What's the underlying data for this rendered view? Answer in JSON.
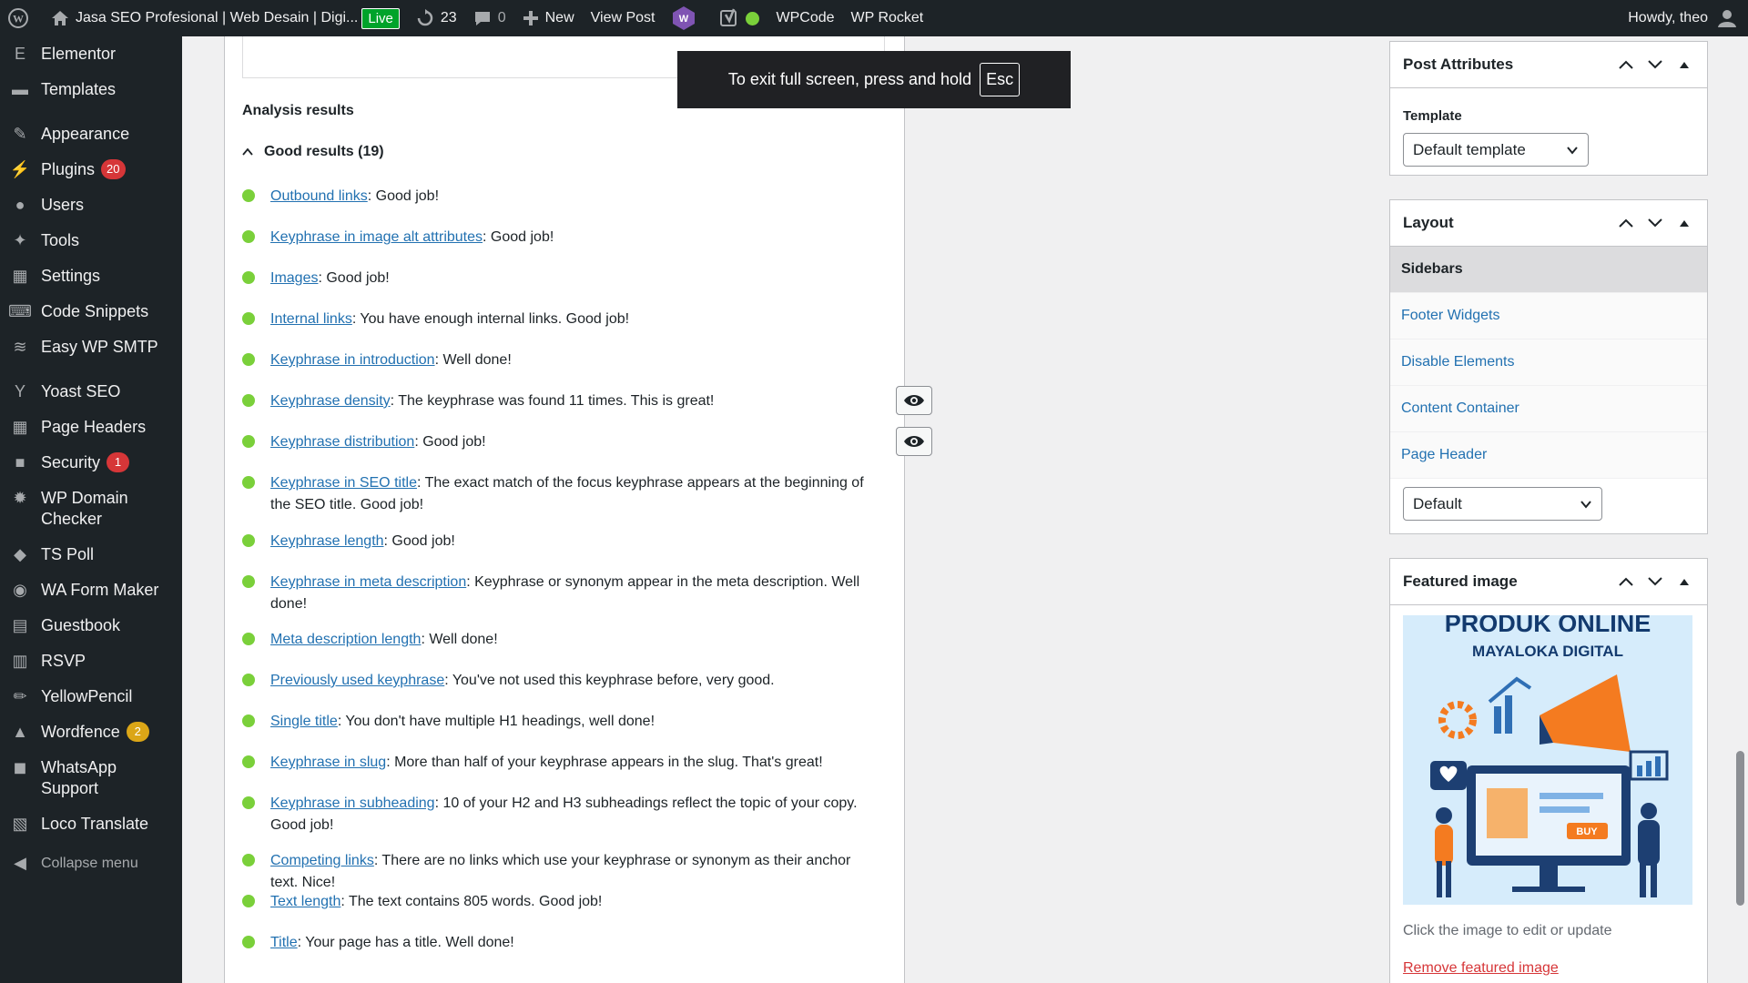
{
  "adminbar": {
    "site_title": "Jasa SEO Profesional | Web Desain | Digi...",
    "live_label": "Live",
    "updates_count": "23",
    "comments_count": "0",
    "new_label": "New",
    "view_post_label": "View Post",
    "wpcode_label": "WPCode",
    "wprocket_label": "WP Rocket",
    "howdy_label": "Howdy, theo"
  },
  "menu": {
    "items": [
      {
        "label": "Elementor",
        "icon": "elementor-icon"
      },
      {
        "label": "Templates",
        "icon": "folder-icon"
      },
      {
        "label": "Appearance",
        "icon": "brush-icon"
      },
      {
        "label": "Plugins",
        "icon": "plugin-icon",
        "count": "20"
      },
      {
        "label": "Users",
        "icon": "user-icon"
      },
      {
        "label": "Tools",
        "icon": "wrench-icon"
      },
      {
        "label": "Settings",
        "icon": "settings-icon"
      },
      {
        "label": "Code Snippets",
        "icon": "code-icon"
      },
      {
        "label": "Easy WP SMTP",
        "icon": "mail-icon"
      },
      {
        "label": "Yoast SEO",
        "icon": "yoast-icon"
      },
      {
        "label": "Page Headers",
        "icon": "grid-icon"
      },
      {
        "label": "Security",
        "icon": "lock-icon",
        "count": "1"
      },
      {
        "label": "WP Domain Checker",
        "icon": "gear-icon"
      },
      {
        "label": "TS Poll",
        "icon": "poll-icon"
      },
      {
        "label": "WA Form Maker",
        "icon": "whatsapp-icon"
      },
      {
        "label": "Guestbook",
        "icon": "comment-icon"
      },
      {
        "label": "RSVP",
        "icon": "calendar-icon"
      },
      {
        "label": "YellowPencil",
        "icon": "pencil-icon"
      },
      {
        "label": "Wordfence",
        "icon": "wordfence-icon",
        "count": "2"
      },
      {
        "label": "WhatsApp Support",
        "icon": "chat-icon"
      },
      {
        "label": "Loco Translate",
        "icon": "translate-icon"
      }
    ],
    "collapse_label": "Collapse menu"
  },
  "analysis": {
    "heading": "Analysis results",
    "good_label": "Good results (19)",
    "results": [
      {
        "link": "Outbound links",
        "text": ": Good job!"
      },
      {
        "link": "Keyphrase in image alt attributes",
        "text": ": Good job!"
      },
      {
        "link": "Images",
        "text": ": Good job!"
      },
      {
        "link": "Internal links",
        "text": ": You have enough internal links. Good job!"
      },
      {
        "link": "Keyphrase in introduction",
        "text": ": Well done!"
      },
      {
        "link": "Keyphrase density",
        "text": ": The keyphrase was found 11 times. This is great!"
      },
      {
        "link": "Keyphrase distribution",
        "text": ": Good job!"
      },
      {
        "link": "Keyphrase in SEO title",
        "text": ": The exact match of the focus keyphrase appears at the beginning of the SEO title. Good job!"
      },
      {
        "link": "Keyphrase length",
        "text": ": Good job!"
      },
      {
        "link": "Keyphrase in meta description",
        "text": ": Keyphrase or synonym appear in the meta description. Well done!"
      },
      {
        "link": "Meta description length",
        "text": ": Well done!"
      },
      {
        "link": "Previously used keyphrase",
        "text": ": You've not used this keyphrase before, very good."
      },
      {
        "link": "Single title",
        "text": ": You don't have multiple H1 headings, well done!"
      },
      {
        "link": "Keyphrase in slug",
        "text": ": More than half of your keyphrase appears in the slug. That's great!"
      },
      {
        "link": "Keyphrase in subheading",
        "text": ": 10 of your H2 and H3 subheadings reflect the topic of your copy. Good job!"
      },
      {
        "link": "Competing links",
        "text": ": There are no links which use your keyphrase or synonym as their anchor text. Nice!"
      },
      {
        "link": "Text length",
        "text": ": The text contains 805 words. Good job!"
      },
      {
        "link": "Title",
        "text": ": Your page has a title. Well done!"
      }
    ]
  },
  "post_attributes": {
    "title": "Post Attributes",
    "template_label": "Template",
    "template_value": "Default template"
  },
  "layout": {
    "title": "Layout",
    "tabs": [
      "Sidebars",
      "Footer Widgets",
      "Disable Elements",
      "Content Container",
      "Page Header"
    ],
    "select_value": "Default"
  },
  "featured": {
    "title": "Featured image",
    "image_title_line1": "PRODUK ONLINE",
    "image_title_line2": "MAYALOKA DIGITAL",
    "buy_label": "BUY",
    "hint": "Click the image to edit or update",
    "remove_label": "Remove featured image"
  },
  "fullscreen_toast": {
    "text": "To exit full screen, press and hold",
    "key": "Esc"
  },
  "colors": {
    "good_dot": "#7ad03a",
    "link": "#2271b1",
    "adminbar_bg": "#1d2327",
    "remove_link": "#d63638"
  }
}
